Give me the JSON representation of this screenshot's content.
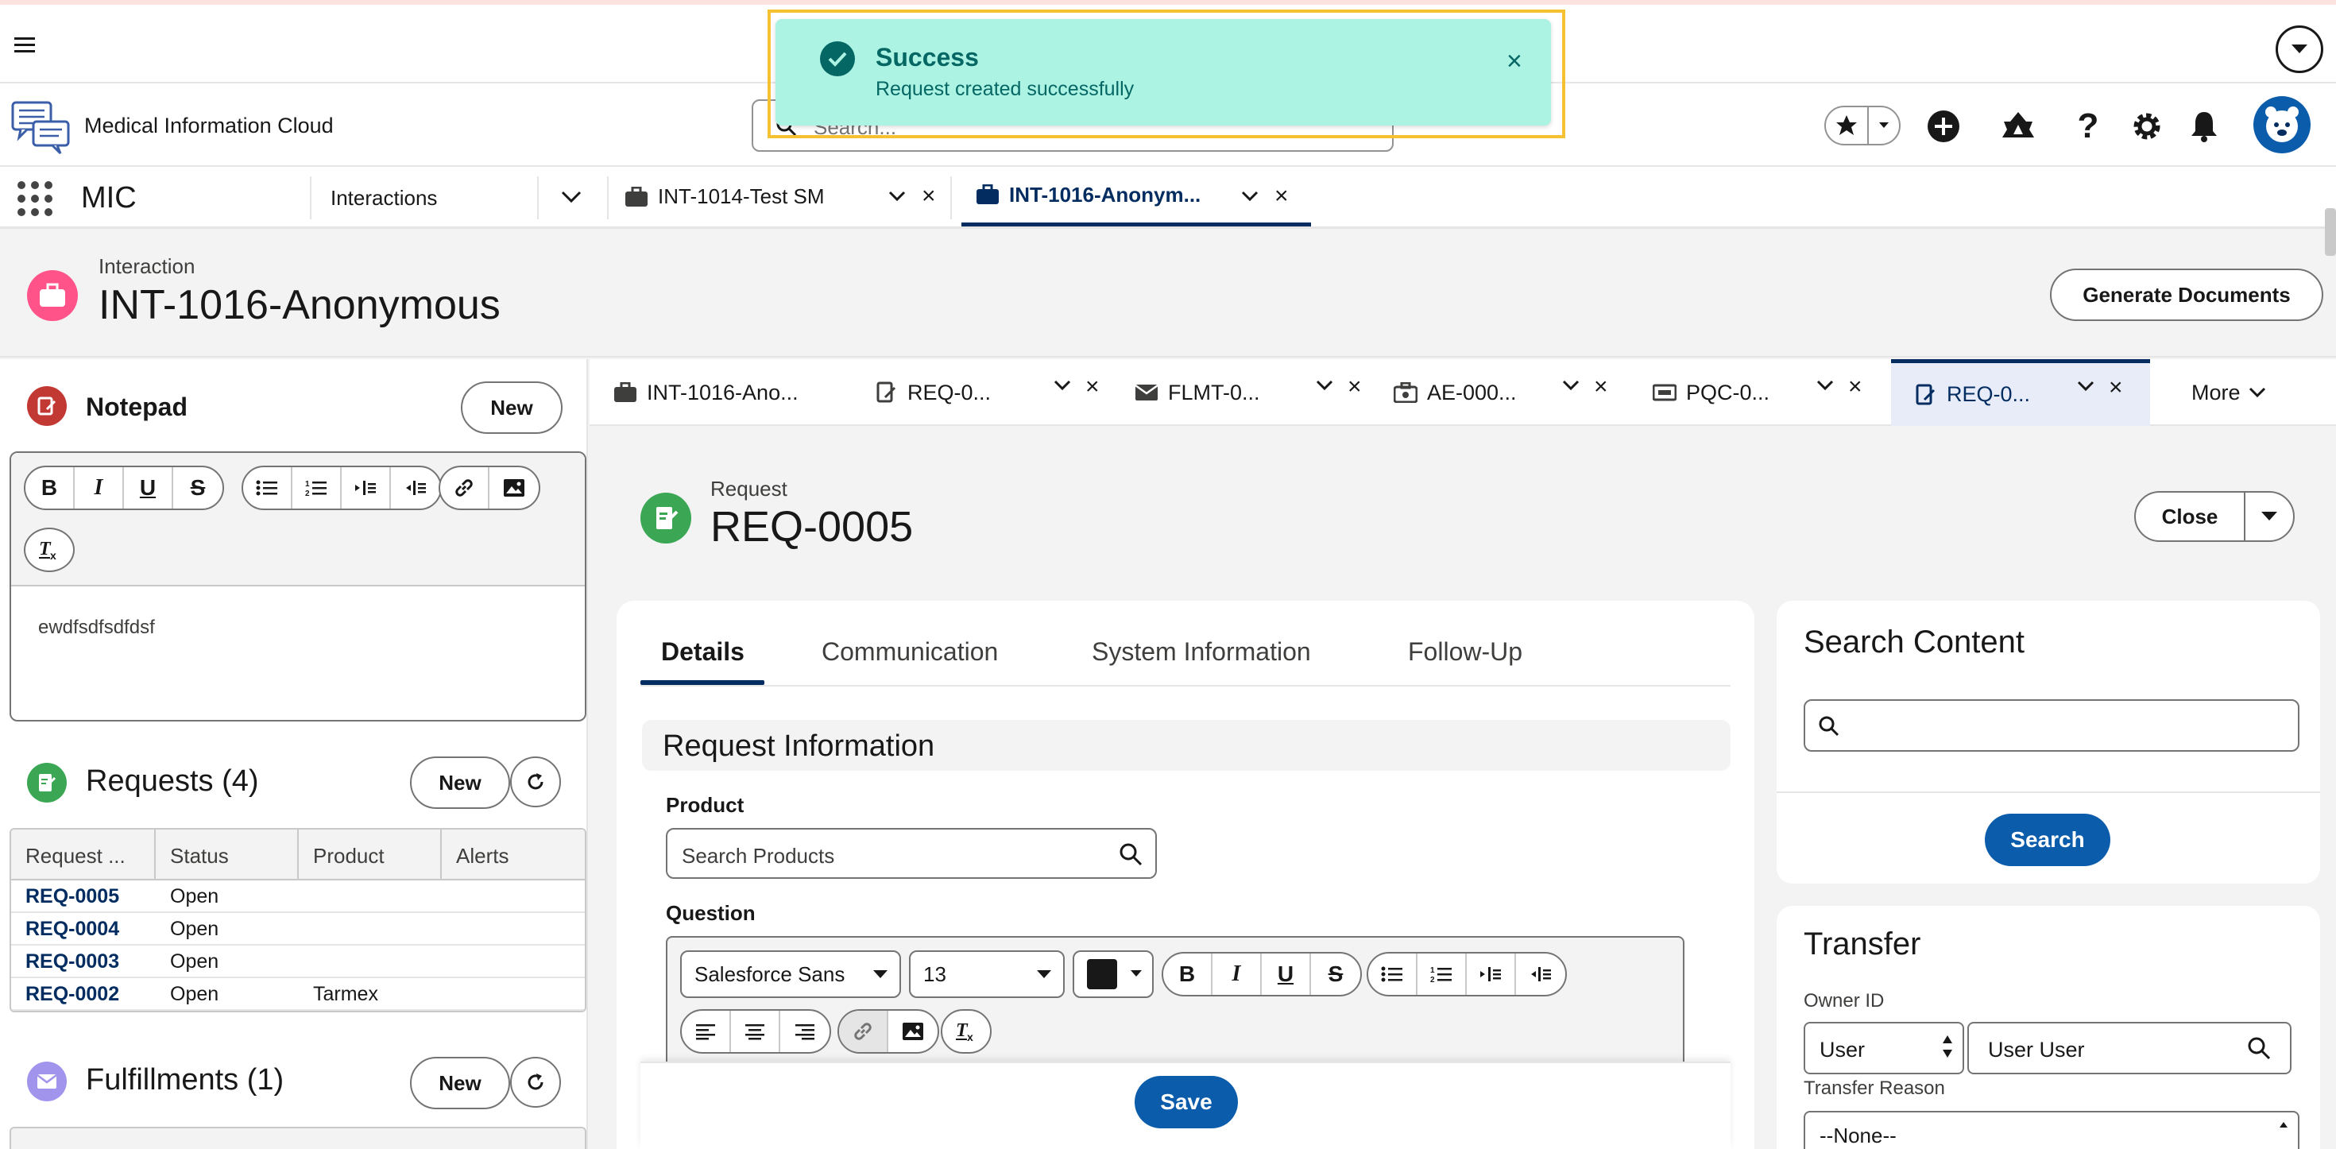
{
  "toast": {
    "title": "Success",
    "message": "Request created successfully",
    "close": "×",
    "icon": "check-icon",
    "color": "#acf3e4"
  },
  "header": {
    "app_name": "Medical Information Cloud",
    "search_placeholder": "Search...",
    "help": "?"
  },
  "nav": {
    "app": "MIC",
    "items": [
      {
        "label": "Interactions"
      },
      {
        "label": "INT-1014-Test SM"
      },
      {
        "label": "INT-1016-Anonym..."
      }
    ]
  },
  "record": {
    "object_label": "Interaction",
    "title": "INT-1016-Anonymous",
    "generate_docs": "Generate Documents"
  },
  "notepad": {
    "title": "Notepad",
    "new": "New",
    "toolbar": [
      "B",
      "I",
      "U",
      "S"
    ],
    "text": "ewdfsdfsdfdsf"
  },
  "requests": {
    "title": "Requests (4)",
    "new": "New",
    "columns": [
      "Request ...",
      "Status",
      "Product",
      "Alerts"
    ],
    "rows": [
      {
        "id": "REQ-0005",
        "status": "Open",
        "product": ""
      },
      {
        "id": "REQ-0004",
        "status": "Open",
        "product": ""
      },
      {
        "id": "REQ-0003",
        "status": "Open",
        "product": ""
      },
      {
        "id": "REQ-0002",
        "status": "Open",
        "product": "Tarmex"
      }
    ]
  },
  "fulfillments": {
    "title": "Fulfillments (1)",
    "new": "New"
  },
  "subtabs": [
    {
      "label": "INT-1016-Ano..."
    },
    {
      "label": "REQ-0..."
    },
    {
      "label": "FLMT-0..."
    },
    {
      "label": "AE-000..."
    },
    {
      "label": "PQC-0..."
    },
    {
      "label": "REQ-0..."
    }
  ],
  "more": "More",
  "request": {
    "object_label": "Request",
    "title": "REQ-0005",
    "close": "Close",
    "tabs": [
      "Details",
      "Communication",
      "System Information",
      "Follow-Up"
    ],
    "section": "Request Information",
    "product_label": "Product",
    "product_placeholder": "Search Products",
    "question_label": "Question",
    "font_family": "Salesforce Sans",
    "font_size": "13",
    "save": "Save"
  },
  "search_content": {
    "title": "Search Content",
    "button": "Search"
  },
  "transfer": {
    "title": "Transfer",
    "owner_label": "Owner ID",
    "owner_type": "User",
    "owner_value": "User User",
    "reason_label": "Transfer Reason",
    "reason_value": "--None--"
  },
  "colors": {
    "brand": "#0b5cab",
    "nav_active": "#032d60",
    "request_icon": "#3ba755",
    "interaction_icon": "#ff538a"
  }
}
